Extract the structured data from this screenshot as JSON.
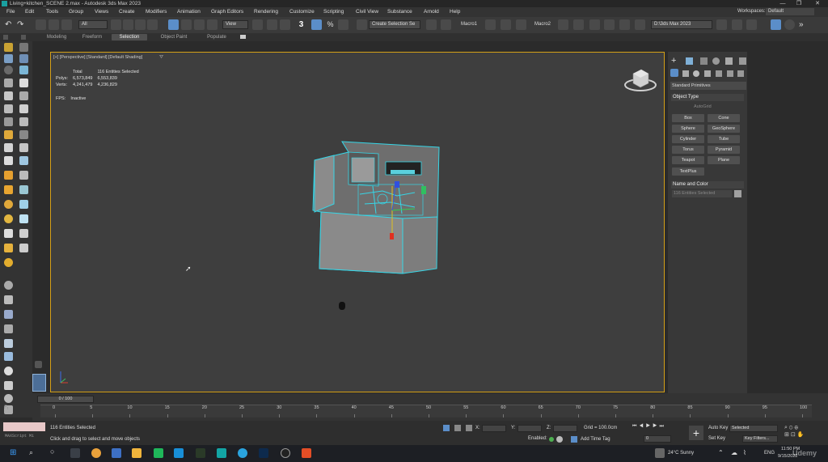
{
  "window": {
    "title": "Living+kitchen_SCENE 2.max - Autodesk 3ds Max 2023",
    "controls": [
      "—",
      "❐",
      "✕"
    ]
  },
  "menu": {
    "items": [
      "File",
      "Edit",
      "Tools",
      "Group",
      "Views",
      "Create",
      "Modifiers",
      "Animation",
      "Graph Editors",
      "Rendering",
      "Customize",
      "Scripting",
      "Civil View",
      "Substance",
      "Arnold",
      "Help"
    ],
    "workspace_label": "Workspaces:",
    "workspace_value": "Default"
  },
  "toolbar": {
    "filter_value": "All",
    "view_value": "View",
    "selection_set_placeholder": "Create Selection Se",
    "macro1": "Macro1",
    "macro2": "Macro2",
    "project_path": "D:\\3ds Max 2023",
    "snap_value": "3"
  },
  "ribbon": {
    "tabs": [
      "Modeling",
      "Freeform",
      "Selection",
      "Object Paint",
      "Populate"
    ],
    "active": "Selection"
  },
  "viewport": {
    "label": "[+] [Perspective] [Standard] [Default Shading]",
    "stats": {
      "col_total": "Total",
      "col_selected": "116 Entities Selected",
      "polys_label": "Polys:",
      "polys_total": "6,573,849",
      "polys_sel": "6,553,839",
      "verts_label": "Verts:",
      "verts_total": "4,241,479",
      "verts_sel": "4,236,829"
    },
    "fps_label": "FPS:",
    "fps_value": "Inactive"
  },
  "command_panel": {
    "category": "Standard Primitives",
    "object_type_title": "Object Type",
    "autogrid": "AutoGrid",
    "buttons": [
      "Box",
      "Cone",
      "Sphere",
      "GeoSphere",
      "Cylinder",
      "Tube",
      "Torus",
      "Pyramid",
      "Teapot",
      "Plane",
      "TextPlus"
    ],
    "name_color_title": "Name and Color",
    "name_value": "116 Entities Selected",
    "swatch_color": "#a0a0a0"
  },
  "timeline": {
    "frame_range": "0 / 100",
    "ticks": [
      "0",
      "5",
      "10",
      "15",
      "20",
      "25",
      "30",
      "35",
      "40",
      "45",
      "50",
      "55",
      "60",
      "65",
      "70",
      "75",
      "80",
      "85",
      "90",
      "95",
      "100"
    ]
  },
  "status": {
    "selection": "116 Entities Selected",
    "prompt": "Click and drag to select and move objects",
    "script_label": "MAXScript Mi",
    "x_label": "X:",
    "y_label": "Y:",
    "z_label": "Z:",
    "grid": "Grid = 100.0cm",
    "enabled": "Enabled:",
    "add_time_tag": "Add Time Tag",
    "autokey": "Auto Key",
    "selected": "Selected",
    "setkey": "Set Key",
    "key_filters": "Key Filters...",
    "frame_value": "0"
  },
  "taskbar": {
    "weather": "24°C Sunny",
    "lang": "ENG",
    "time": "11:50 PM",
    "date": "9/15/2022",
    "watermark": "Udemy"
  },
  "colors": {
    "accent_blue": "#5b8ec9",
    "viewport_border": "#d4a017",
    "wire_cyan": "#36d6e7"
  }
}
